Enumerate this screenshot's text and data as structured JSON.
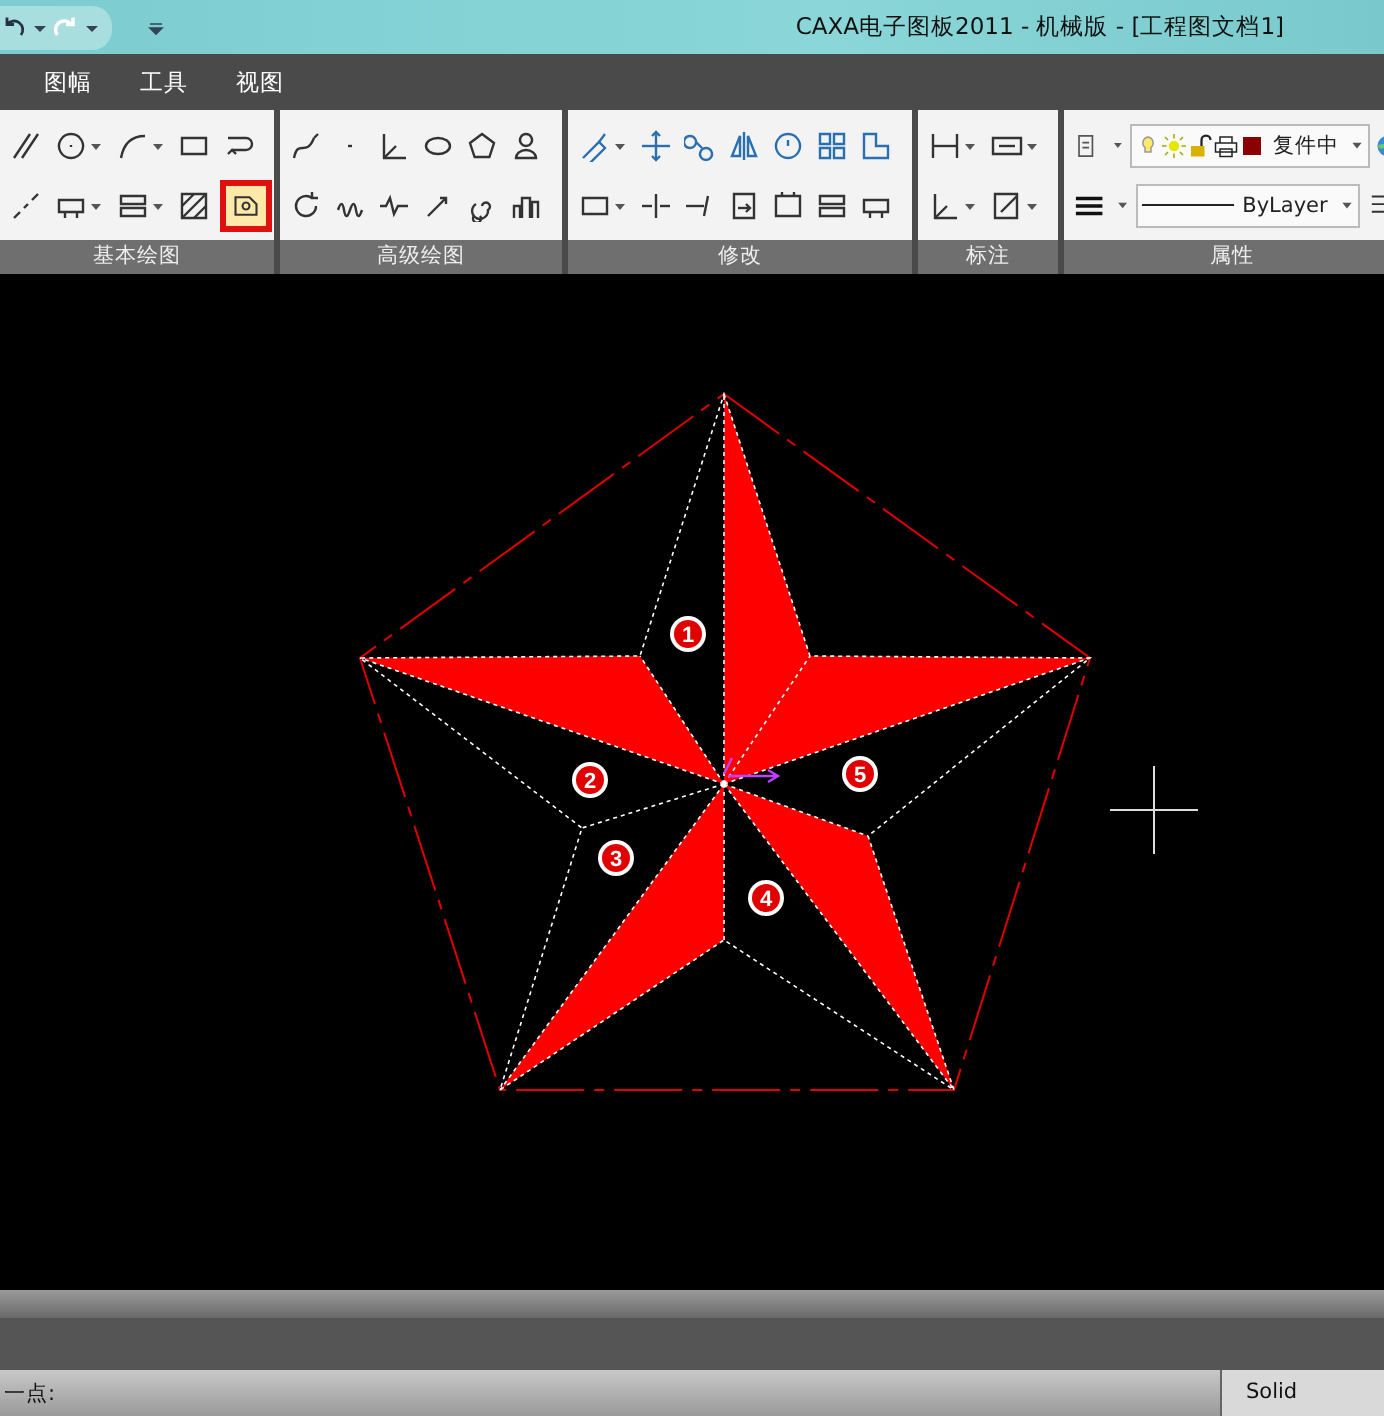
{
  "window": {
    "title": "CAXA电子图板2011 - 机械版 - [工程图文档1]"
  },
  "menu": [
    {
      "label": "图幅"
    },
    {
      "label": "工具"
    },
    {
      "label": "视图"
    }
  ],
  "ribbon": [
    {
      "label": "基本绘图",
      "tools": [
        {
          "dropdown": false,
          "selected": false
        },
        {
          "dropdown": true,
          "selected": false
        },
        {
          "dropdown": true,
          "selected": false
        },
        {
          "dropdown": false,
          "selected": false
        },
        {
          "dropdown": false,
          "selected": false
        },
        {
          "dropdown": false,
          "selected": false
        },
        {
          "dropdown": true,
          "selected": false
        },
        {
          "dropdown": true,
          "selected": false
        },
        {
          "dropdown": false,
          "selected": false
        },
        {
          "dropdown": false,
          "selected": true
        }
      ]
    },
    {
      "label": "高级绘图",
      "tools": [
        {
          "dropdown": false,
          "selected": false
        },
        {
          "dropdown": false,
          "selected": false
        },
        {
          "dropdown": false,
          "selected": false
        },
        {
          "dropdown": false,
          "selected": false
        },
        {
          "dropdown": false,
          "selected": false
        },
        {
          "dropdown": false,
          "selected": false
        },
        {
          "dropdown": false,
          "selected": false
        },
        {
          "dropdown": false,
          "selected": false
        },
        {
          "dropdown": false,
          "selected": false
        },
        {
          "dropdown": false,
          "selected": false
        },
        {
          "dropdown": false,
          "selected": false
        },
        {
          "dropdown": false,
          "selected": false
        }
      ]
    },
    {
      "label": "修改",
      "tools": [
        {
          "dropdown": true,
          "selected": false
        },
        {
          "dropdown": false,
          "selected": false
        },
        {
          "dropdown": false,
          "selected": false
        },
        {
          "dropdown": false,
          "selected": false
        },
        {
          "dropdown": false,
          "selected": false
        },
        {
          "dropdown": false,
          "selected": false
        },
        {
          "dropdown": false,
          "selected": false
        },
        {
          "dropdown": true,
          "selected": false
        },
        {
          "dropdown": false,
          "selected": false
        },
        {
          "dropdown": false,
          "selected": false
        },
        {
          "dropdown": false,
          "selected": false
        },
        {
          "dropdown": false,
          "selected": false
        },
        {
          "dropdown": false,
          "selected": false
        },
        {
          "dropdown": false,
          "selected": false
        }
      ]
    },
    {
      "label": "标注",
      "tools": [
        {
          "dropdown": true,
          "selected": false
        },
        {
          "dropdown": true,
          "selected": false
        },
        {
          "dropdown": true,
          "selected": false
        },
        {
          "dropdown": true,
          "selected": false
        }
      ]
    },
    {
      "label": "属性",
      "layer": "复件中",
      "linetype": "ByLayer"
    }
  ],
  "drawing": {
    "markers": [
      "1",
      "2",
      "3",
      "4",
      "5"
    ]
  },
  "status_bar": {
    "prompt": "一点:",
    "line_style": "Solid"
  }
}
